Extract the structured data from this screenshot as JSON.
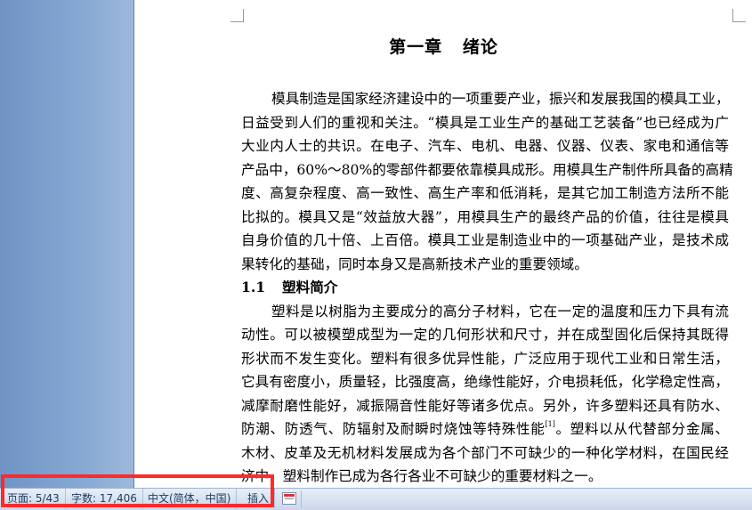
{
  "document": {
    "chapter_title": "第一章   绪论",
    "lines": [
      {
        "text": "模具制造是国家经济建设中的一项重要产业，振兴和发展我国的模具工业，",
        "indent": true
      },
      {
        "text": "日益受到人们的重视和关注。“模具是工业生产的基础工艺装备”也已经成为广"
      },
      {
        "text": "大业内人士的共识。在电子、汽车、电机、电器、仪器、仪表、家电和通信等"
      },
      {
        "text": "产品中，60%～80%的零部件都要依靠模具成形。用模具生产制件所具备的高精"
      },
      {
        "text": "度、高复杂程度、高一致性、高生产率和低消耗，是其它加工制造方法所不能"
      },
      {
        "text": "比拟的。模具又是“效益放大器”，用模具生产的最终产品的价值，往往是模具"
      },
      {
        "text": "自身价值的几十倍、上百倍。模具工业是制造业中的一项基础产业，是技术成"
      },
      {
        "text": "果转化的基础，同时本身又是高新技术产业的重要领域。",
        "last": true
      },
      {
        "section_number": "1.1",
        "section_title": "塑料简介",
        "section": true
      },
      {
        "text": "塑料是以树脂为主要成分的高分子材料，它在一定的温度和压力下具有流",
        "indent": true
      },
      {
        "text": "动性。可以被模塑成型为一定的几何形状和尺寸，并在成型固化后保持其既得"
      },
      {
        "text": "形状而不发生变化。塑料有很多优异性能，广泛应用于现代工业和日常生活，"
      },
      {
        "text": "它具有密度小，质量轻，比强度高，绝缘性能好，介电损耗低，化学稳定性高，"
      },
      {
        "text": "减摩耐磨性能好，减振隔音性能好等诸多优点。另外，许多塑料还具有防水、"
      },
      {
        "text": "防潮、防透气、防辐射及耐瞬时烧蚀等特殊性能",
        "cite": "[1]",
        "text_after": "。塑料以从代替部分金属、"
      },
      {
        "text": "木材、皮革及无机材料发展成为各个部门不可缺少的一种化学材料，在国民经"
      },
      {
        "text": "济中，塑料制作已成为各行各业不可缺少的重要材料之一。",
        "last": true
      }
    ]
  },
  "statusbar": {
    "page": "页面: 5/43",
    "words": "字数: 17,406",
    "language": "中文(简体，中国)",
    "mode": "插入",
    "highlight_color": "#ff2a2a"
  }
}
